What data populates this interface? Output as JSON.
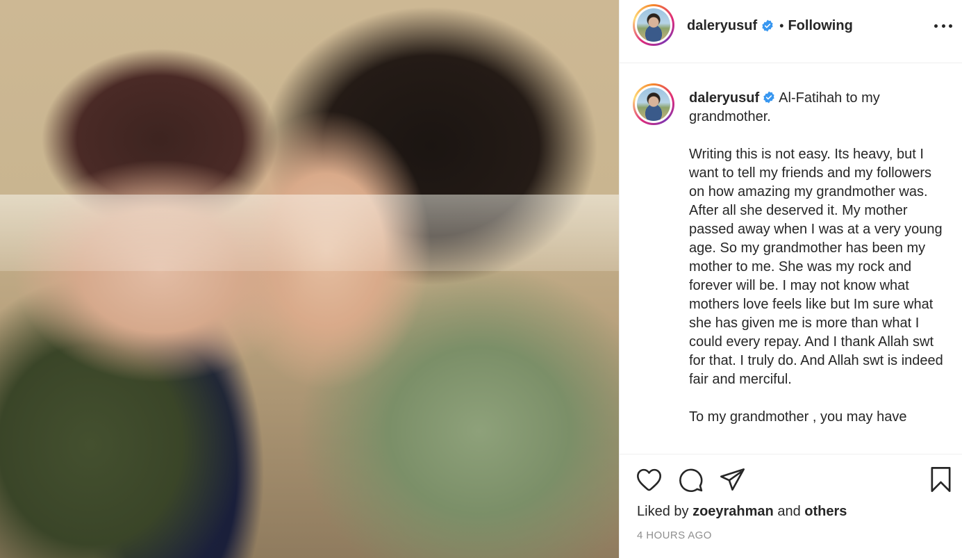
{
  "post": {
    "photo_alt": "",
    "author": "daleryusuf",
    "follow_status": "Following",
    "separator": "•"
  },
  "caption": {
    "username": "daleryusuf",
    "first_line": "Al-Fatihah to my grandmother.",
    "paragraph_2": "Writing this is not easy. Its heavy, but I want to tell my friends and my followers on how amazing my grandmother was. After all she deserved it. My mother passed away when I was at a very young age. So my grandmother has been my mother to me. She was my rock and forever will be. I may not know what mothers love feels like but Im sure what she has given me is more than what I could every repay. And I thank Allah swt for that. I truly do. And Allah swt is indeed fair and merciful.",
    "paragraph_3": "To my grandmother , you may have"
  },
  "likes": {
    "prefix": "Liked by",
    "user": "zoeyrahman",
    "joiner": "and",
    "others": "others"
  },
  "timestamp": "4 HOURS AGO",
  "icons": {
    "like": "heart-icon",
    "comment": "comment-bubble-icon",
    "share": "paper-plane-icon",
    "save": "bookmark-icon",
    "more": "more-options-icon",
    "verified": "verified-badge-icon"
  },
  "colors": {
    "verified_blue": "#3897f0",
    "text": "#262626",
    "muted": "#8e8e8e",
    "divider": "#efefef"
  }
}
